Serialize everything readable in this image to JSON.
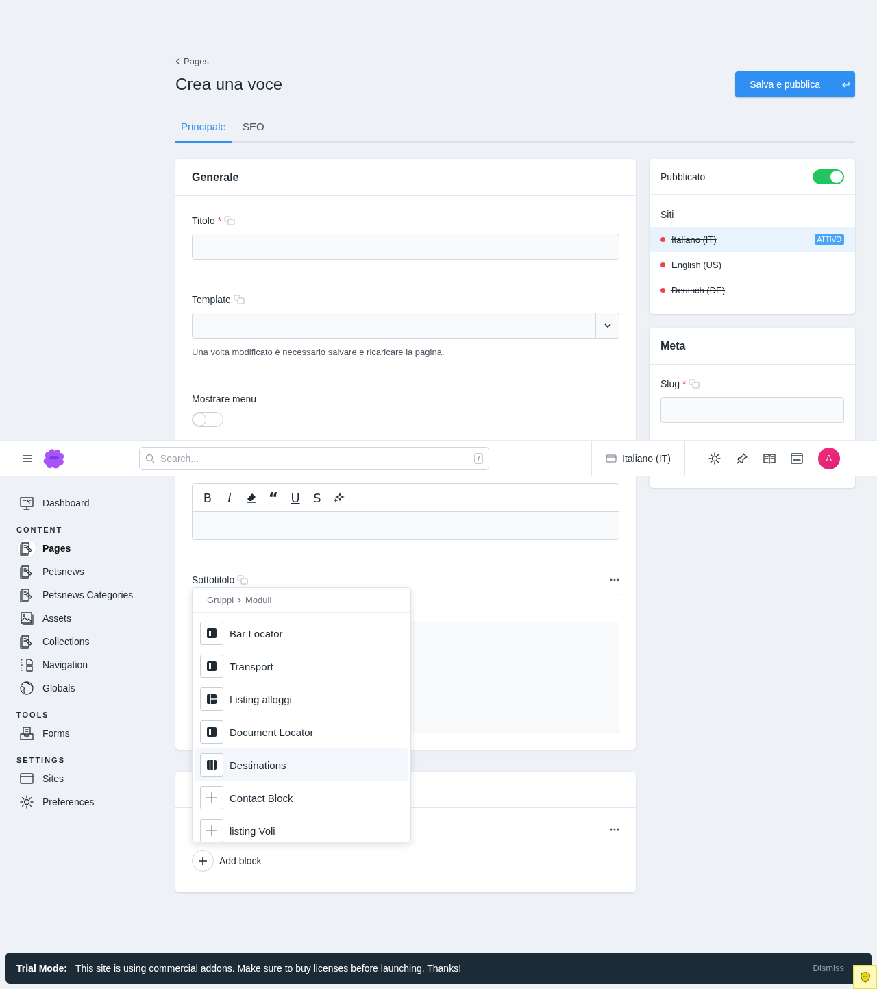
{
  "header": {
    "search": {
      "placeholder": "Search...",
      "shortcut": "/"
    },
    "site": "Italiano (IT)",
    "avatar": "A"
  },
  "sidebar": {
    "items": [
      {
        "label": "Dashboard",
        "kind": "dashboard",
        "selected": false
      }
    ],
    "sections": [
      {
        "heading": "CONTENT",
        "items": [
          {
            "label": "Pages",
            "kind": "entries",
            "selected": true
          },
          {
            "label": "Petsnews",
            "kind": "entries",
            "selected": false
          },
          {
            "label": "Petsnews Categories",
            "kind": "entries",
            "selected": false
          },
          {
            "label": "Assets",
            "kind": "assets",
            "selected": false
          },
          {
            "label": "Collections",
            "kind": "entries",
            "selected": false
          },
          {
            "label": "Navigation",
            "kind": "navigation",
            "selected": false
          },
          {
            "label": "Globals",
            "kind": "globe",
            "selected": false
          }
        ]
      },
      {
        "heading": "TOOLS",
        "items": [
          {
            "label": "Forms",
            "kind": "forms",
            "selected": false
          }
        ]
      },
      {
        "heading": "SETTINGS",
        "items": [
          {
            "label": "Sites",
            "kind": "sites",
            "selected": false
          },
          {
            "label": "Preferences",
            "kind": "gear",
            "selected": false
          }
        ]
      }
    ]
  },
  "breadcrumb": "Pages",
  "title": "Crea una voce",
  "publish_button": "Salva e pubblica",
  "tabs": [
    {
      "label": "Principale",
      "selected": true
    },
    {
      "label": "SEO",
      "selected": false
    }
  ],
  "main_section": {
    "title": "Generale",
    "fields": [
      {
        "kind": "text",
        "label": "Titolo",
        "required_marker": "*",
        "translatable": true
      },
      {
        "kind": "select",
        "label": "Template",
        "translatable": true,
        "help": "Una volta modificato è necessario salvare e ricaricare la pagina."
      },
      {
        "kind": "toggle",
        "label": "Mostrare menu",
        "translatable": false,
        "on": false
      },
      {
        "kind": "editor",
        "toolbar": [
          {
            "kind": "bold",
            "glyph": "B"
          },
          {
            "kind": "italic",
            "glyph": "I"
          },
          {
            "kind": "eraser"
          },
          {
            "kind": "quote",
            "glyph": "“"
          },
          {
            "kind": "underline",
            "glyph": "U"
          },
          {
            "kind": "strike",
            "glyph": "S"
          },
          {
            "kind": "sparkle"
          }
        ]
      },
      {
        "kind": "bard",
        "label": "Sottotitolo",
        "translatable": true
      }
    ]
  },
  "blocks_section": {
    "add_label": "Add block"
  },
  "block_picker": {
    "path": [
      "Gruppi",
      "Moduli"
    ],
    "items": [
      {
        "label": "Bar Locator",
        "kind": "half",
        "selected": false
      },
      {
        "label": "Transport",
        "kind": "half",
        "selected": false
      },
      {
        "label": "Listing alloggi",
        "kind": "layout",
        "selected": false
      },
      {
        "label": "Document Locator",
        "kind": "half",
        "selected": false
      },
      {
        "label": "Destinations",
        "kind": "columns",
        "selected": true
      },
      {
        "label": "Contact Block",
        "kind": "plus",
        "selected": false
      },
      {
        "label": "listing Voli",
        "kind": "plus",
        "selected": false
      }
    ]
  },
  "publish_panel": {
    "label": "Pubblicato",
    "on": true,
    "sites_heading": "Siti",
    "sites": [
      {
        "name": "Italiano (IT)",
        "selected": true,
        "exists": false,
        "badge": "ATTIVO"
      },
      {
        "name": "English (US)",
        "selected": false,
        "exists": false
      },
      {
        "name": "Deutsch (DE)",
        "selected": false,
        "exists": false
      }
    ]
  },
  "meta_panel": {
    "title": "Meta",
    "fields": [
      {
        "label": "Slug",
        "required_marker": "*",
        "translatable": true
      }
    ]
  },
  "trial_banner": {
    "label": "Trial Mode:",
    "message": "This site is using commercial addons. Make sure to buy licenses before launching. Thanks!",
    "dismiss": "Dismiss"
  }
}
